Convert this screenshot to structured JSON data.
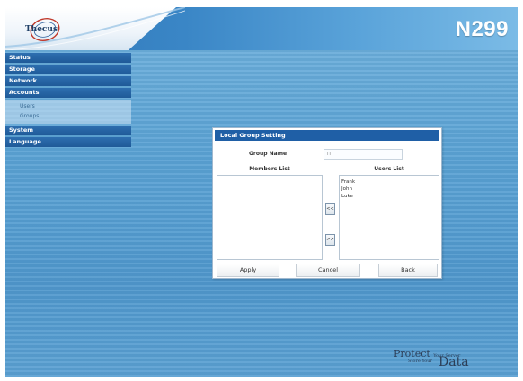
{
  "header": {
    "brand_logo": "Thecus",
    "product_name": "N299"
  },
  "sidebar": {
    "items": [
      {
        "label": "Status"
      },
      {
        "label": "Storage"
      },
      {
        "label": "Network"
      },
      {
        "label": "Accounts"
      },
      {
        "label": "System"
      },
      {
        "label": "Language"
      }
    ],
    "accounts_sub": [
      {
        "label": "Users"
      },
      {
        "label": "Groups"
      }
    ]
  },
  "dialog": {
    "title": "Local Group Setting",
    "group_name_label": "Group Name",
    "group_name_value": "IT",
    "members_header": "Members List",
    "users_header": "Users List",
    "users": [
      "Frank",
      "John",
      "Luke"
    ],
    "add_label": "<<",
    "remove_label": ">>",
    "apply_label": "Apply",
    "cancel_label": "Cancel",
    "back_label": "Back"
  },
  "tagline": {
    "line1_main": "Protect",
    "line1_small": "Your Server",
    "line2": "Store Your",
    "data_word": "Data"
  },
  "colors": {
    "accent": "#1f5fa6",
    "nav": "#2e6fb0",
    "background": "#5aa2d4"
  }
}
